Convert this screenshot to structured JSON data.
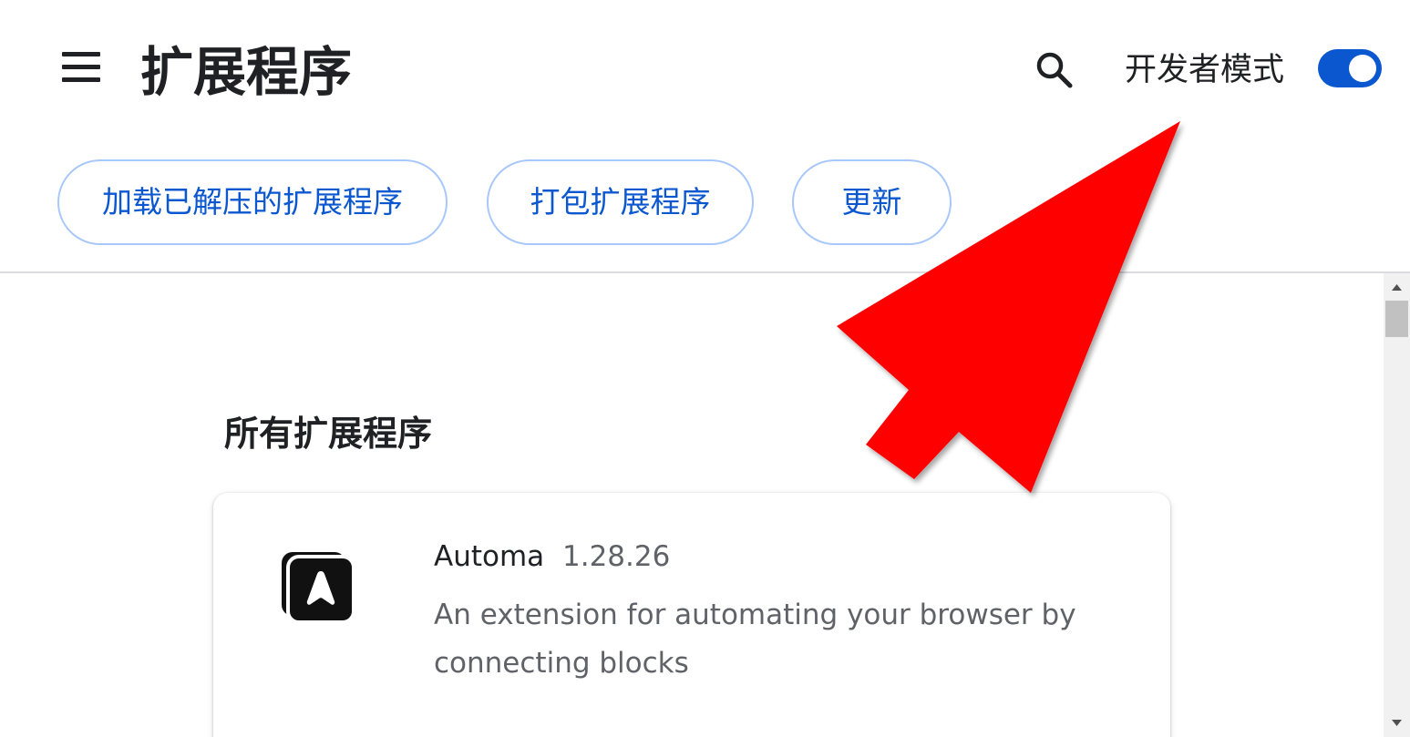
{
  "toolbar": {
    "menu_icon": "hamburger-menu-icon",
    "title": "扩展程序",
    "search_icon": "search-icon",
    "developer_mode_label": "开发者模式",
    "developer_mode_on": true,
    "buttons": {
      "load_unpacked": "加载已解压的扩展程序",
      "pack_extension": "打包扩展程序",
      "update": "更新"
    }
  },
  "main": {
    "section_title": "所有扩展程序",
    "extensions": [
      {
        "name": "Automa",
        "version": "1.28.26",
        "description": "An extension for automating your browser by connecting blocks",
        "icon": "automa-logo-icon"
      }
    ]
  },
  "colors": {
    "accent": "#0b57d0",
    "pill_border": "#a8c7fa",
    "annotation_arrow": "#ff0000"
  },
  "annotation": {
    "type": "arrow",
    "color": "#ff0000",
    "points_to": "developer-mode-toggle"
  }
}
